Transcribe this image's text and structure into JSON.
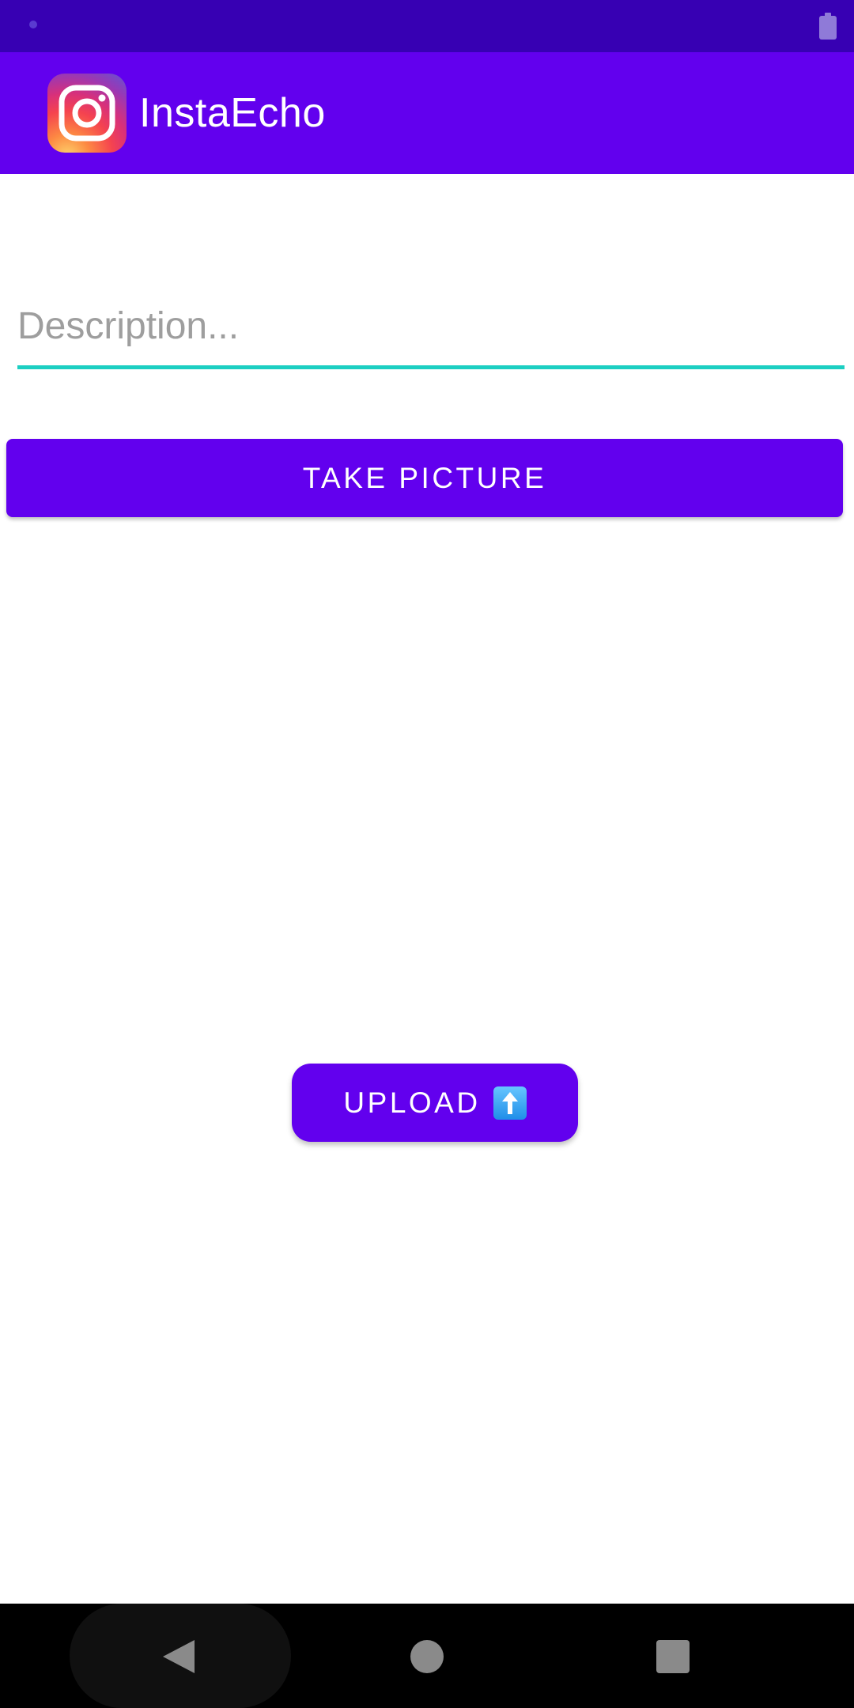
{
  "app": {
    "title": "InstaEcho",
    "logo_icon": "instagram-camera-icon"
  },
  "status_bar": {
    "icons": [
      "notification-dot-icon",
      "battery-icon"
    ]
  },
  "form": {
    "description_value": "",
    "description_placeholder": "Description..."
  },
  "buttons": {
    "take_picture_label": "TAKE PICTURE",
    "upload_label": "UPLOAD",
    "upload_icon": "up-arrow-emoji-icon"
  },
  "nav_bar": {
    "icons": [
      "back-icon",
      "home-icon",
      "recents-icon"
    ]
  },
  "colors": {
    "status_bar": "#3700b3",
    "primary": "#6200ee",
    "accent_underline": "#1ccfc2",
    "background": "#ffffff"
  }
}
